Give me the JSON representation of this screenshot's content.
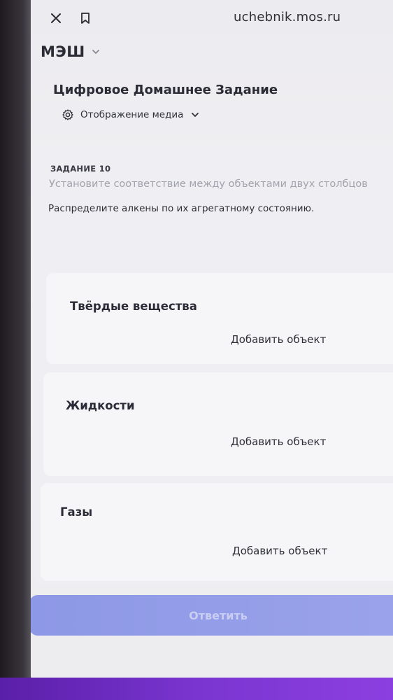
{
  "browser": {
    "url": "uchebnik.mos.ru",
    "icons": [
      "close-icon",
      "bookmark-icon"
    ]
  },
  "brand": {
    "name": "МЭШ"
  },
  "header": {
    "title": "Цифровое Домашнее Задание",
    "media_toggle_label": "Отображение медиа"
  },
  "task": {
    "number": "ЗАДАНИЕ 10",
    "instruction": "Установите соответствие между объектами двух столбцов",
    "question": "Распределите алкены по их агрегатному состоянию.",
    "groups": [
      {
        "title": "Твёрдые вещества",
        "add_label": "Добавить объект"
      },
      {
        "title": "Жидкости",
        "add_label": "Добавить объект"
      },
      {
        "title": "Газы",
        "add_label": "Добавить объект"
      }
    ],
    "submit_label": "Ответить"
  },
  "colors": {
    "submit": "#8d98e6",
    "bottom_bar": "#7a35d0"
  }
}
